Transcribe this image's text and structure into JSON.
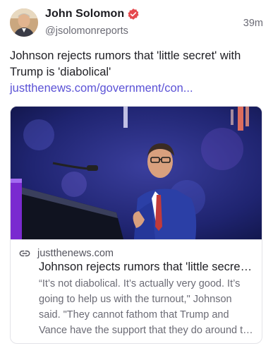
{
  "post": {
    "author": {
      "display_name": "John Solomon",
      "handle": "@jsolomonreports",
      "verified_icon": "verified-badge-icon",
      "avatar_icon": "avatar-photo"
    },
    "timestamp": "39m",
    "text": "Johnson rejects rumors that 'little secret' with Trump is 'diabolical' ",
    "text_link": "justthenews.com/government/con...",
    "link_color": "#5b52d6"
  },
  "card": {
    "image_icon": "speaker-at-podium-photo",
    "domain_icon": "link-icon",
    "domain": "justthenews.com",
    "title": "Johnson rejects rumors that 'little secret' with Trump is 'diabolical'",
    "description": "“It’s not diabolical. It’s actually very good. It’s going to help us with the turnout,\" Johnson said. \"They cannot fathom that Trump and Vance have the support that they do around the country.\""
  }
}
